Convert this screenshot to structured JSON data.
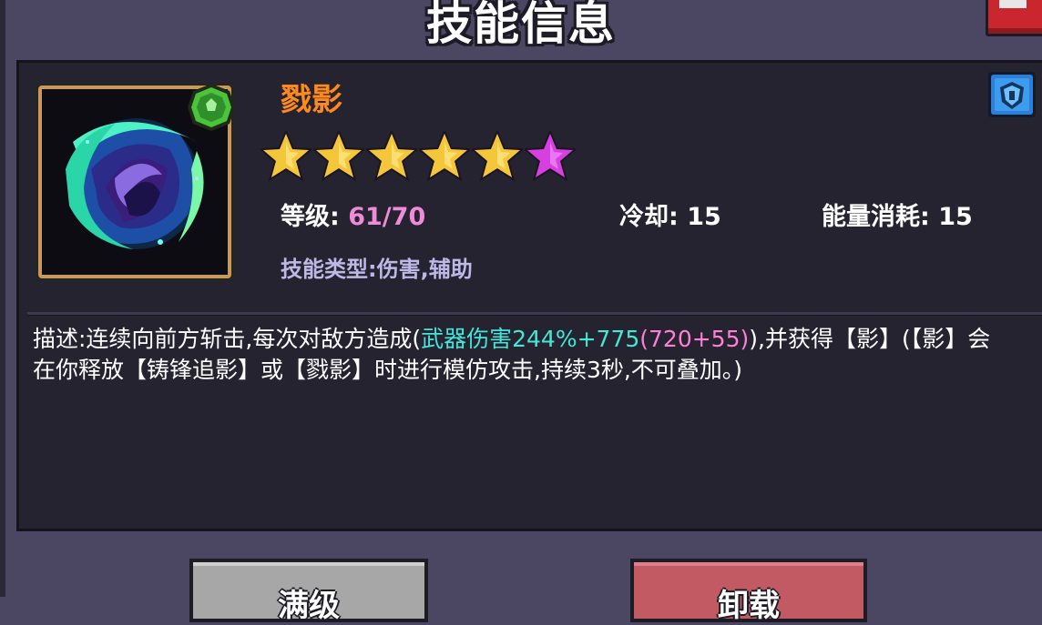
{
  "window": {
    "title": "技能信息"
  },
  "skill": {
    "name": "戮影",
    "stars_total": 6,
    "stars_gold": 5,
    "stars_special": 1,
    "level_label": "等级:",
    "level_value": "61/70",
    "cooldown_label": "冷却:",
    "cooldown_value": "15",
    "energy_label": "能量消耗:",
    "energy_value": "15",
    "type_text": "技能类型:伤害,辅助"
  },
  "description": {
    "part1": "描述:连续向前方斩击,每次对敌方造成(",
    "highlight": "武器伤害244%+775",
    "highlight2": "(720+55)",
    "part2": "),并获得【影】(【影】会在你释放【铸锋追影】或【戮影】时进行模仿攻击,持续3秒,不可叠加。)"
  },
  "buttons": {
    "upgrade": "满级",
    "unload": "卸载"
  },
  "icons": {
    "skill": "shadow-slash-skill-icon",
    "grade": "green-gem-icon",
    "badge": "blue-shield-icon",
    "close": "close-icon"
  },
  "colors": {
    "skill_name": "#ff8a1c",
    "level_value": "#f08bd9",
    "highlight": "#44e6d8",
    "star_gold": "#f4c73b",
    "star_special": "#d63fe0"
  }
}
